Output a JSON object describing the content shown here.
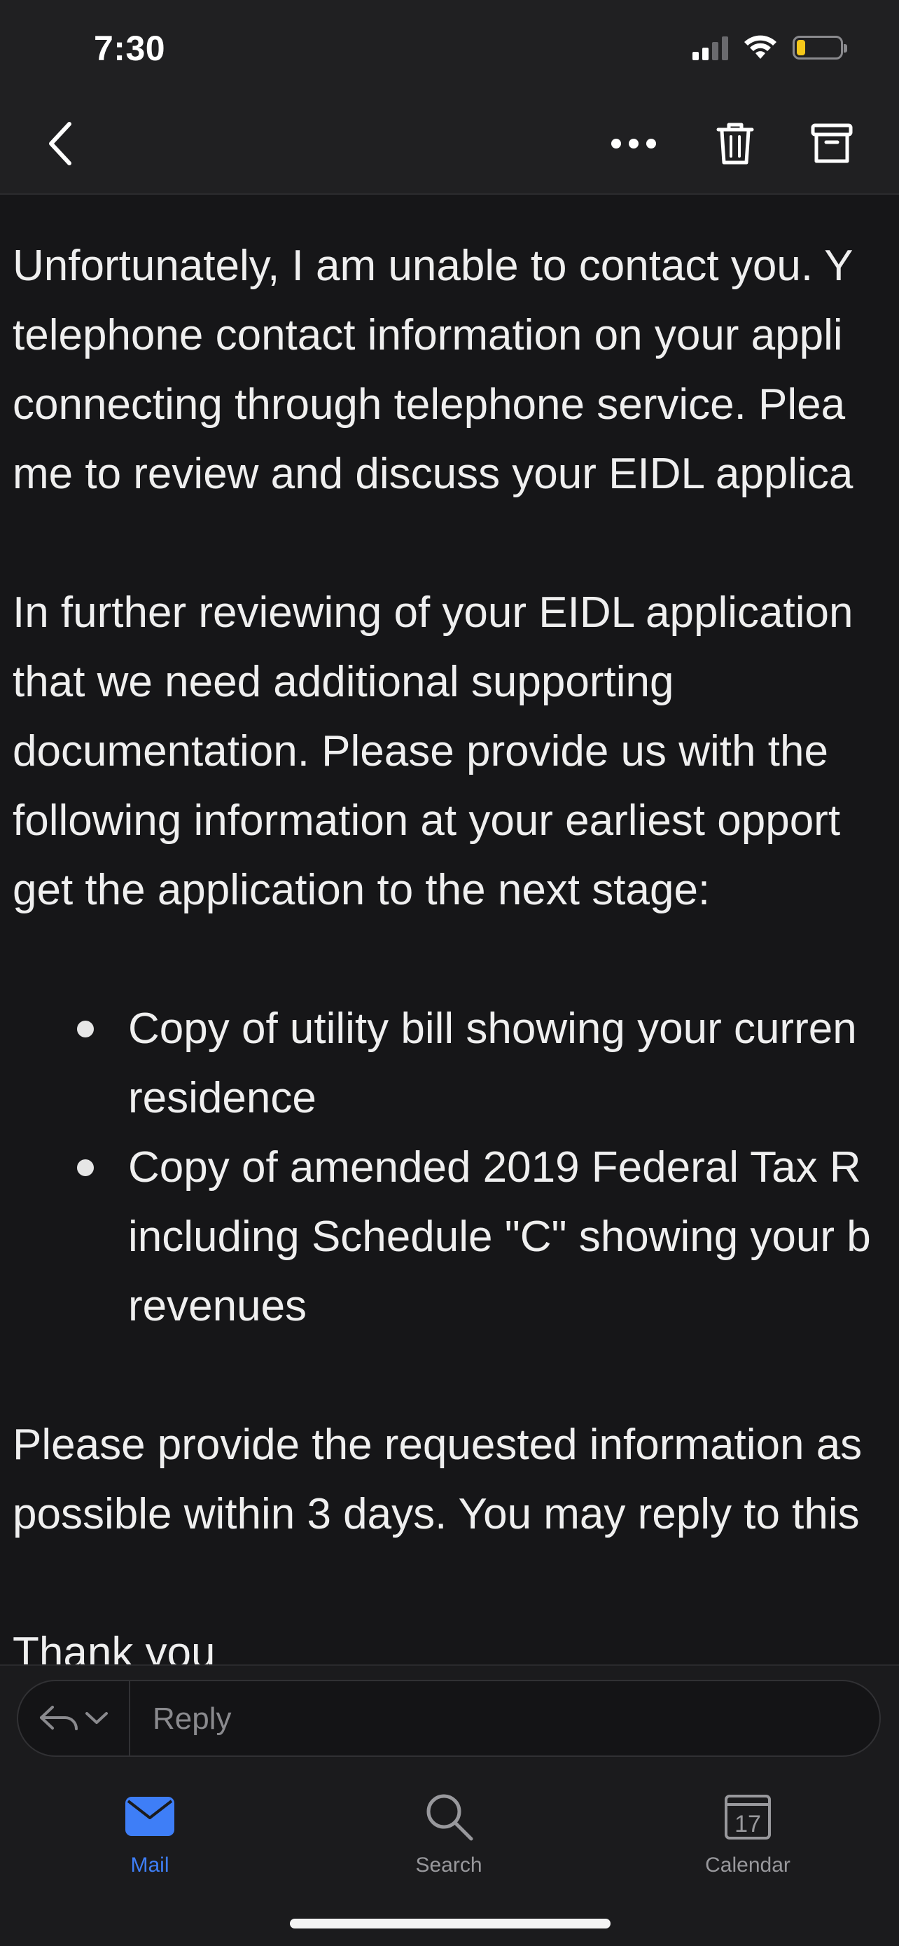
{
  "status_bar": {
    "time": "7:30"
  },
  "colors": {
    "background": "#161618",
    "toolbar": "#202022",
    "accent_blue": "#3e7ef7",
    "battery_yellow": "#f5c71a",
    "muted_text": "#98989c"
  },
  "toolbar": {
    "icons": [
      "back-chevron-icon",
      "more-icon",
      "trash-icon",
      "archive-icon"
    ]
  },
  "email": {
    "paragraph_1": [
      "Unfortunately, I am unable to contact you. Y",
      "telephone contact information on your appli",
      "connecting through telephone service. Plea",
      "me to review and discuss your EIDL applica"
    ],
    "paragraph_2": [
      "In further reviewing of your EIDL application",
      "that we need additional supporting",
      "documentation. Please provide us with the",
      "following information at your earliest opport",
      "get the application to the next stage:"
    ],
    "bullets": [
      {
        "lines": [
          "Copy of utility bill showing your curren",
          "residence"
        ]
      },
      {
        "lines": [
          "Copy of amended 2019 Federal Tax R",
          "including Schedule \"C\" showing your b",
          "revenues"
        ]
      }
    ],
    "paragraph_3": [
      "Please provide the requested information as",
      "possible within 3 days. You may reply to this"
    ],
    "closing": "Thank you"
  },
  "reply": {
    "placeholder": "Reply"
  },
  "tabbar": {
    "tabs": [
      {
        "label": "Mail",
        "icon": "mail-icon",
        "active": true
      },
      {
        "label": "Search",
        "icon": "search-icon",
        "active": false
      },
      {
        "label": "Calendar",
        "icon": "calendar-icon",
        "active": false,
        "day": "17"
      }
    ]
  }
}
